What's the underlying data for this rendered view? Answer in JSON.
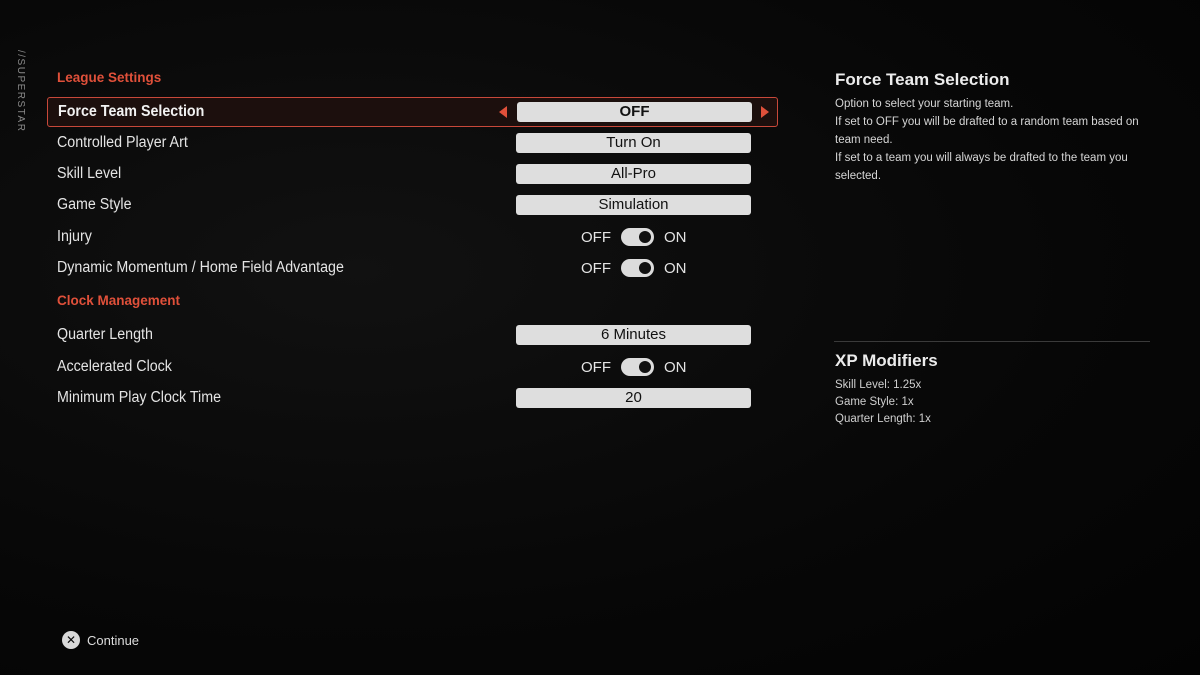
{
  "side_tag": "//SUPERSTAR",
  "sections": [
    {
      "title": "League Settings",
      "rows": [
        {
          "label": "Force Team Selection",
          "type": "select",
          "value": "OFF",
          "selected": true
        },
        {
          "label": "Controlled Player Art",
          "type": "select",
          "value": "Turn On"
        },
        {
          "label": "Skill Level",
          "type": "select",
          "value": "All-Pro"
        },
        {
          "label": "Game Style",
          "type": "select",
          "value": "Simulation"
        },
        {
          "label": "Injury",
          "type": "toggle",
          "off_label": "OFF",
          "on_label": "ON",
          "state": "on"
        },
        {
          "label": "Dynamic Momentum / Home Field Advantage",
          "type": "toggle",
          "off_label": "OFF",
          "on_label": "ON",
          "state": "on"
        }
      ]
    },
    {
      "title": "Clock Management",
      "rows": [
        {
          "label": "Quarter Length",
          "type": "select",
          "value": "6 Minutes"
        },
        {
          "label": "Accelerated Clock",
          "type": "toggle",
          "off_label": "OFF",
          "on_label": "ON",
          "state": "on"
        },
        {
          "label": "Minimum Play Clock Time",
          "type": "select",
          "value": "20"
        }
      ]
    }
  ],
  "info": {
    "title": "Force Team Selection",
    "lines": [
      "Option to select your starting team.",
      "If set to OFF you will be drafted to a random team based on team need.",
      "If set to a team you will always be drafted to the team you selected."
    ]
  },
  "xp": {
    "title": "XP Modifiers",
    "items": [
      "Skill Level: 1.25x",
      "Game Style: 1x",
      "Quarter Length: 1x"
    ]
  },
  "footer": {
    "button_icon": "x-button-icon",
    "label": "Continue"
  },
  "colors": {
    "accent": "#e0503a",
    "value_box": "#dedede"
  }
}
